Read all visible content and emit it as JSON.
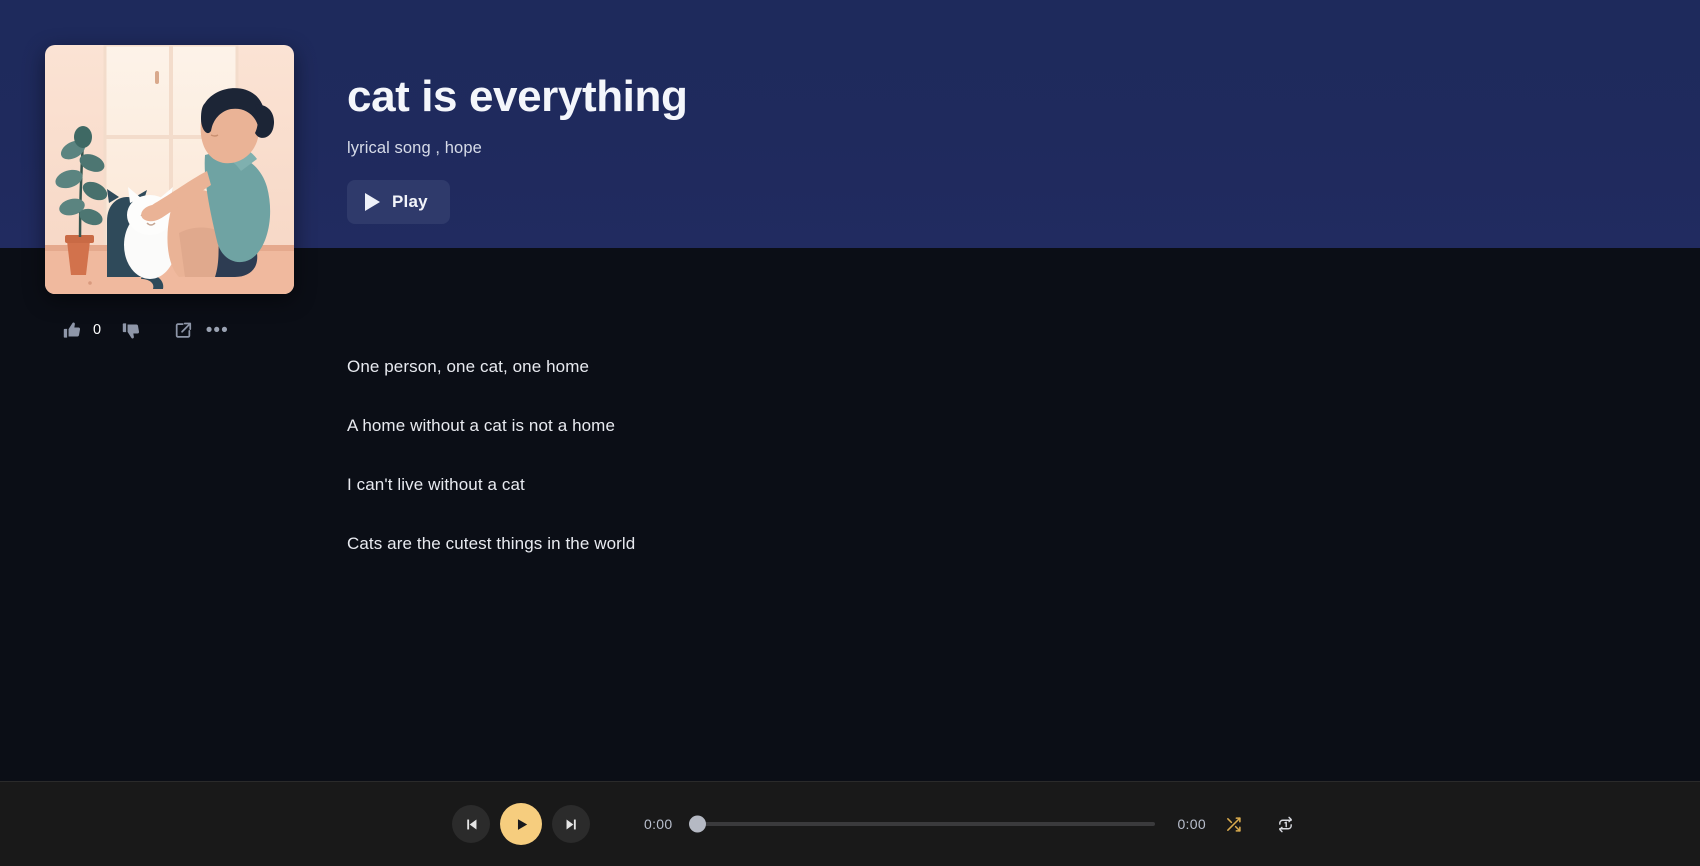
{
  "header": {
    "title": "cat is everything",
    "tags": "lyrical song , hope",
    "play_label": "Play",
    "accent_navy": "#1e2a5c",
    "play_button_bg": "#2f3a6b"
  },
  "album_art": {
    "icon": "album-art-illustration",
    "description": "person sitting by window petting a white cat with a potted plant"
  },
  "actions": {
    "like_icon": "thumbs-up-icon",
    "like_count": "0",
    "dislike_icon": "thumbs-down-icon",
    "share_icon": "share-icon",
    "more_icon": "more-options-icon",
    "more_label": "•••"
  },
  "lyrics": {
    "lines": [
      "One person, one cat, one home",
      "A home without a cat is not a home",
      "I can't live without a cat",
      "Cats are the cutest things in the world"
    ]
  },
  "player": {
    "previous_icon": "skip-previous-icon",
    "play_icon": "play-icon",
    "next_icon": "skip-next-icon",
    "current_time": "0:00",
    "total_time": "0:00",
    "progress_percent": 0,
    "shuffle_icon": "shuffle-icon",
    "repeat_icon": "repeat-one-icon",
    "play_button_color": "#f6cd7e",
    "shuffle_active_color": "#d9ab4e"
  }
}
